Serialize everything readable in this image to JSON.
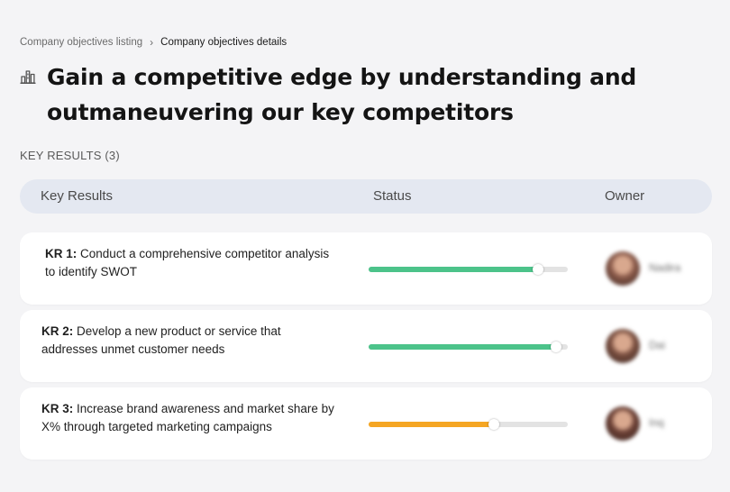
{
  "breadcrumb": {
    "parent": "Company objectives listing",
    "separator": "›",
    "current": "Company objectives details"
  },
  "title": {
    "icon": "building-chart-icon",
    "text": "Gain a competitive edge by understanding and outmaneuvering our key competitors"
  },
  "section_label": "KEY RESULTS (3)",
  "table": {
    "headers": {
      "key_results": "Key Results",
      "status": "Status",
      "owner": "Owner"
    },
    "rows": [
      {
        "prefix": "KR 1:",
        "text": "Conduct a comprehensive competitor analysis to identify SWOT",
        "progress": 0.85,
        "progress_color": "#4cc38a",
        "owner_name": "Nadira",
        "avatar_color": "#8a5a4a"
      },
      {
        "prefix": "KR 2:",
        "text": "Develop a new product or service that addresses unmet customer needs",
        "progress": 0.94,
        "progress_color": "#4cc38a",
        "owner_name": "Dai",
        "avatar_color": "#7a4f40"
      },
      {
        "prefix": "KR 3:",
        "text": "Increase brand awareness and market share by X% through targeted marketing campaigns",
        "progress": 0.63,
        "progress_color": "#f5a623",
        "owner_name": "Inq",
        "avatar_color": "#6b4035"
      }
    ]
  },
  "colors": {
    "background": "#f4f4f6",
    "header_bg": "#e4e8f1",
    "track": "#e3e3e3"
  }
}
